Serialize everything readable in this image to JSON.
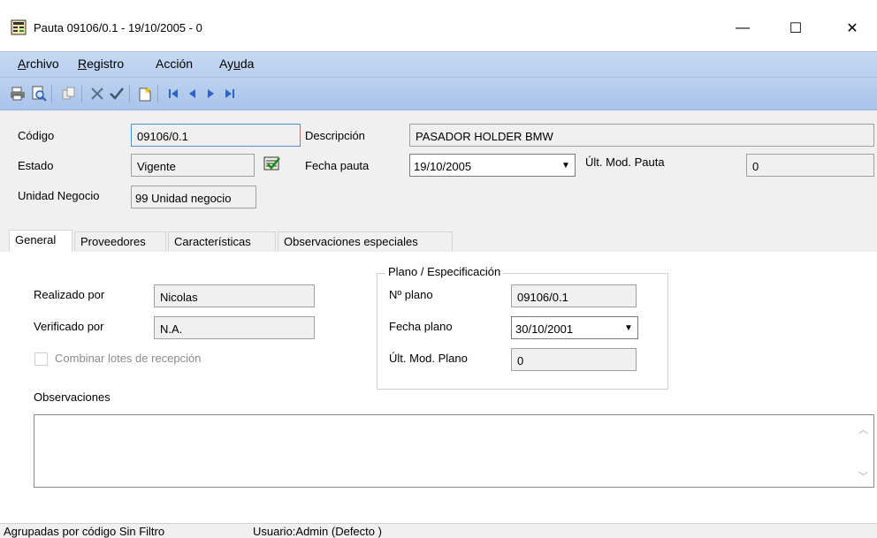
{
  "window": {
    "title": "Pauta 09106/0.1 - 19/10/2005 - 0",
    "controls": {
      "minimize": "—",
      "maximize": "☐",
      "close": "✕"
    }
  },
  "menu": {
    "items": [
      {
        "label": "Archivo",
        "underline": "A"
      },
      {
        "label": "Registro",
        "underline": "R"
      },
      {
        "label": "Acción",
        "underline": ""
      },
      {
        "label": "Ayuda",
        "underline": "u"
      }
    ]
  },
  "toolbar": {
    "icons": [
      "print-icon",
      "print-preview-icon",
      "copy-icon",
      "delete-icon",
      "confirm-icon",
      "new-record-icon",
      "first-record-icon",
      "previous-record-icon",
      "next-record-icon",
      "last-record-icon"
    ]
  },
  "header": {
    "codigo_label": "Código",
    "codigo_value": "09106/0.1",
    "descripcion_label": "Descripción",
    "descripcion_value": "PASADOR HOLDER BMW",
    "estado_label": "Estado",
    "estado_value": "Vigente",
    "fecha_pauta_label": "Fecha pauta",
    "fecha_pauta_value": "19/10/2005",
    "ult_mod_pauta_label": "Últ. Mod. Pauta",
    "ult_mod_pauta_value": "0",
    "unidad_negocio_label": "Unidad Negocio",
    "unidad_negocio_value": "99 Unidad negocio"
  },
  "tabs": [
    {
      "label": "General",
      "active": true
    },
    {
      "label": "Proveedores",
      "active": false
    },
    {
      "label": "Características",
      "active": false
    },
    {
      "label": "Observaciones especiales",
      "active": false
    }
  ],
  "general": {
    "realizado_label": "Realizado por",
    "realizado_value": "Nicolas",
    "verificado_label": "Verificado por",
    "verificado_value": "N.A.",
    "combinar_label": "Combinar lotes de recepción",
    "observaciones_label": "Observaciones",
    "observaciones_value": ""
  },
  "plano": {
    "group_title": "Plano / Especificación",
    "numero_label": "Nº plano",
    "numero_value": "09106/0.1",
    "fecha_label": "Fecha plano",
    "fecha_value": "30/10/2001",
    "ult_mod_label": "Últ. Mod. Plano",
    "ult_mod_value": "0"
  },
  "status": {
    "left": "Agrupadas por código Sin Filtro",
    "user": "Usuario:Admin (Defecto )"
  },
  "colors": {
    "menubar": "#c6d9f2",
    "toolbar": "#a9c4ea",
    "form_bg": "#f0f0f0"
  }
}
